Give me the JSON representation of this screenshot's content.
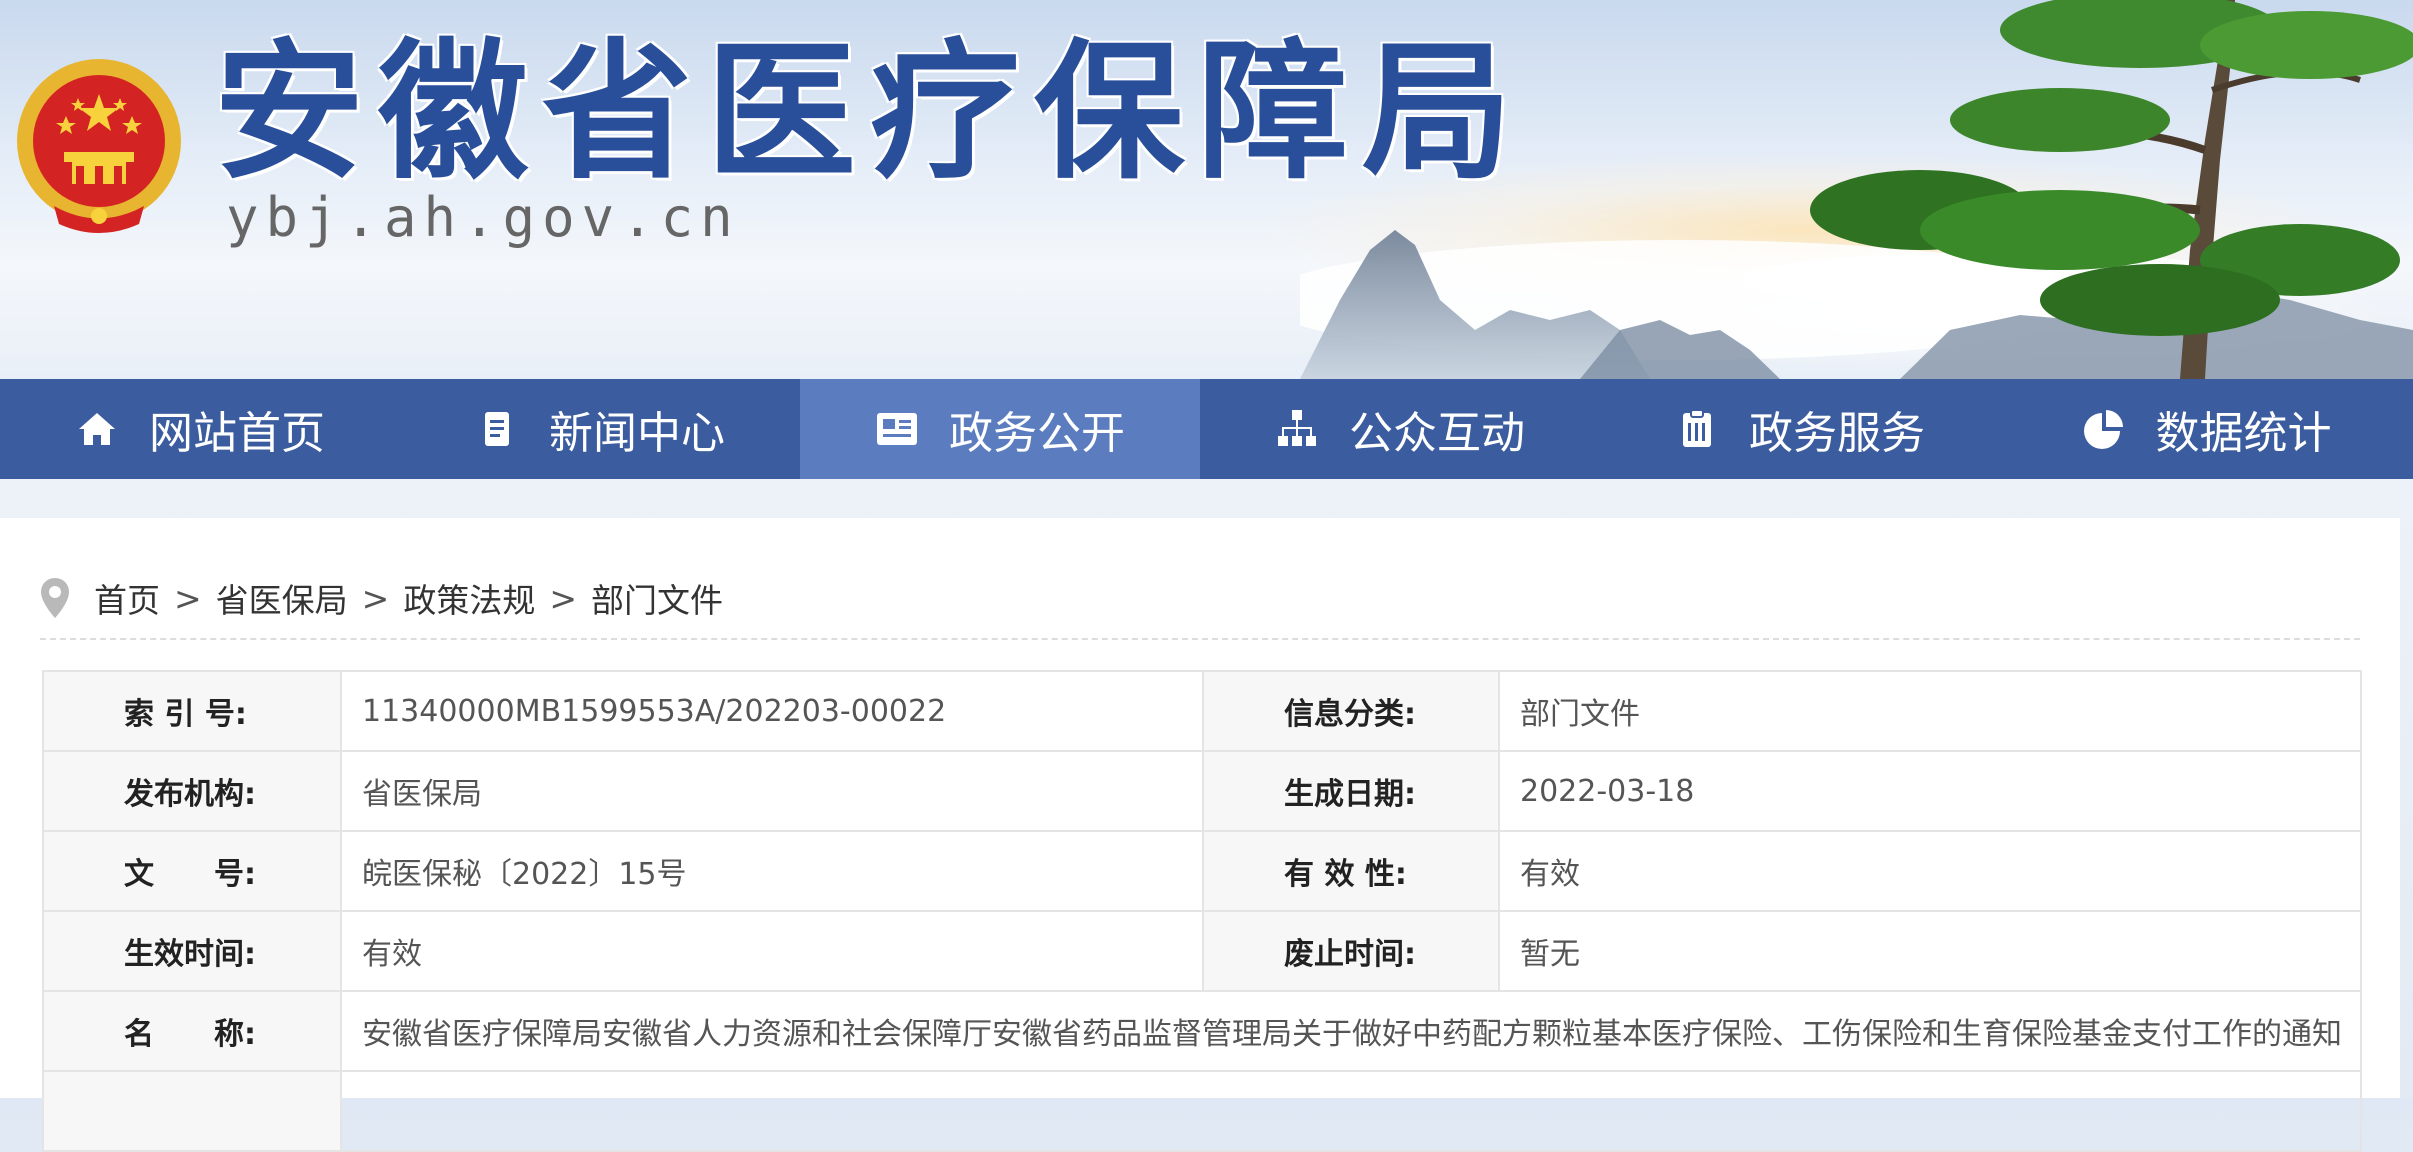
{
  "header": {
    "site_title": "安徽省医疗保障局",
    "domain": "ybj.ah.gov.cn"
  },
  "nav": {
    "items": [
      {
        "label": "网站首页",
        "icon": "home-icon"
      },
      {
        "label": "新闻中心",
        "icon": "document-icon"
      },
      {
        "label": "政务公开",
        "icon": "newspaper-icon",
        "active": true
      },
      {
        "label": "公众互动",
        "icon": "org-chart-icon"
      },
      {
        "label": "政务服务",
        "icon": "clipboard-icon"
      },
      {
        "label": "数据统计",
        "icon": "pie-chart-icon"
      }
    ]
  },
  "breadcrumb": {
    "items": [
      "首页",
      "省医保局",
      "政策法规",
      "部门文件"
    ],
    "separator": ">"
  },
  "meta": {
    "rows": [
      {
        "l1": "索 引 号:",
        "v1": "11340000MB1599553A/202203-00022",
        "l2": "信息分类:",
        "v2": "部门文件"
      },
      {
        "l1": "发布机构:",
        "v1": "省医保局",
        "l2": "生成日期:",
        "v2": "2022-03-18"
      },
      {
        "l1": "文　　号:",
        "v1": "皖医保秘〔2022〕15号",
        "l2": "有 效 性:",
        "v2": "有效"
      },
      {
        "l1": "生效时间:",
        "v1": "有效",
        "l2": "废止时间:",
        "v2": "暂无"
      }
    ],
    "name_label": "名　　称:",
    "name_value": "安徽省医疗保障局安徽省人力资源和社会保障厅安徽省药品监督管理局关于做好中药配方颗粒基本医疗保险、工伤保险和生育保险基金支付工作的通知"
  },
  "colors": {
    "nav_bg": "#3b5c9e",
    "nav_active": "#5b7dbf",
    "title": "#2a4f9a"
  }
}
